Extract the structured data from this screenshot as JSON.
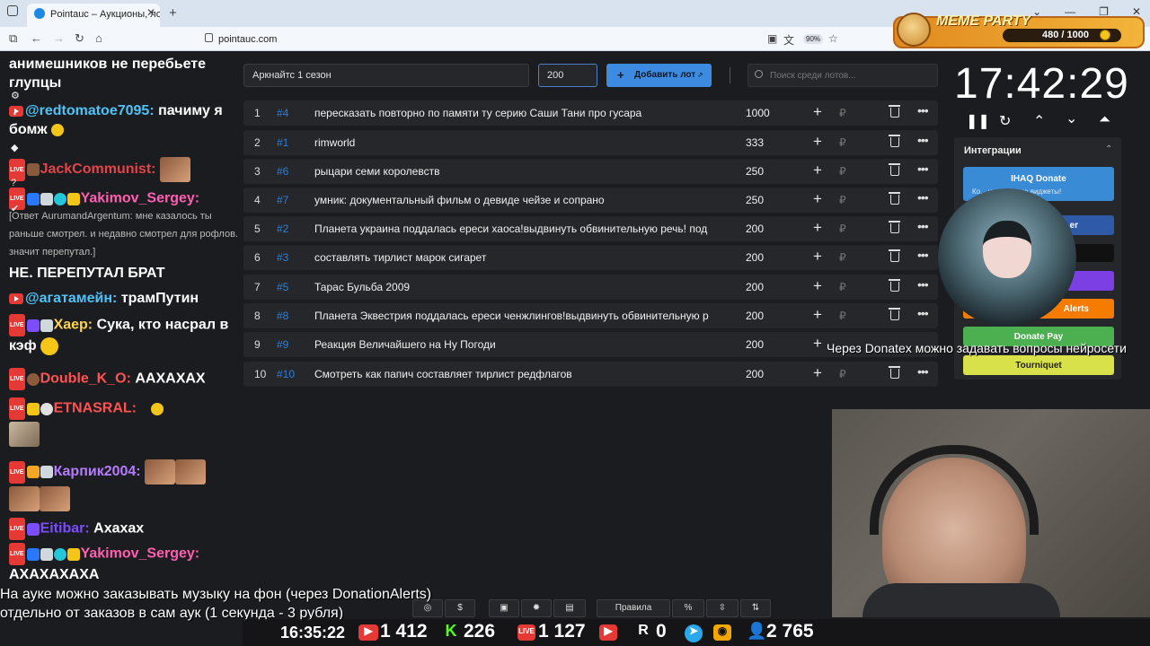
{
  "browser": {
    "tab_title": "Pointauc – Аукционы, лотереи",
    "url": "pointauc.com",
    "zoom": "90%"
  },
  "meme_party": {
    "title": "MEME PARTY",
    "count": "480 / 1000"
  },
  "chat": {
    "messages": [
      {
        "text": "анимешников не перебьете глупцы"
      },
      {
        "user": "@redtomatoe7095:",
        "text": "пачиму я бомж",
        "user_color": "#4fc3f7"
      },
      {
        "user": "JackCommunist:",
        "user_color": "#e0454a"
      },
      {
        "user": "Yakimov_Sergey:",
        "user_color": "#ff5fb0",
        "reply": "[Ответ AurumandArgentum: мне казалось ты раньше смотрел. и недавно смотрел для рофлов. значит перепутал.]",
        "text": "НЕ. ПЕРЕПУТАЛ БРАТ"
      },
      {
        "user": "@агатамейн:",
        "text": "трамПутин",
        "user_color": "#4fc3f7"
      },
      {
        "user": "Хаер:",
        "text": "Сука, кто насрал в кэф",
        "user_color": "#ffd54f"
      },
      {
        "user": "Double_K_O:",
        "text": "ААХАХАХ",
        "user_color": "#ff5252"
      },
      {
        "user": "ETNASRAL:",
        "user_color": "#ff5252"
      },
      {
        "user": "Карпик2004:",
        "user_color": "#b57bff"
      },
      {
        "user": "Eitibar:",
        "text": "Ахахах",
        "user_color": "#7c4dff"
      },
      {
        "user": "Yakimov_Sergey:",
        "text": "АХАХАХАХА",
        "user_color": "#ff5fb0"
      }
    ]
  },
  "form": {
    "lot_name": "Аркнайтс 1 сезон",
    "lot_amount": "200",
    "add_label": "Добавить лот",
    "search_placeholder": "Поиск среди лотов..."
  },
  "lots": [
    {
      "num": "1",
      "id": "#4",
      "name": "пересказать повторно по памяти ту серию Саши Тани про гусара",
      "amount": "1000"
    },
    {
      "num": "2",
      "id": "#1",
      "name": "rimworld",
      "amount": "333"
    },
    {
      "num": "3",
      "id": "#6",
      "name": "рыцари семи королевств",
      "amount": "250"
    },
    {
      "num": "4",
      "id": "#7",
      "name": "умник: документальный фильм о девиде чейзе и сопрано",
      "amount": "250"
    },
    {
      "num": "5",
      "id": "#2",
      "name": "Планета украина поддалась ереси хаоса!выдвинуть обвинительную речь! под",
      "amount": "200"
    },
    {
      "num": "6",
      "id": "#3",
      "name": "составлять тирлист марок сигарет",
      "amount": "200"
    },
    {
      "num": "7",
      "id": "#5",
      "name": "Тарас Бульба 2009",
      "amount": "200"
    },
    {
      "num": "8",
      "id": "#8",
      "name": "Планета Эквестрия поддалась ереси ченжлингов!выдвинуть обвинительную р",
      "amount": "200"
    },
    {
      "num": "9",
      "id": "#9",
      "name": "Реакция Величайшего на Ну Погоди",
      "amount": "200"
    },
    {
      "num": "10",
      "id": "#10",
      "name": "Смотреть как папич составляет тирлист редфлагов",
      "amount": "200"
    }
  ],
  "timer": {
    "value": "17:42:29"
  },
  "integrations": {
    "title": "Интеграции",
    "ihaq_label": "IHAQ Donate",
    "ihaq_sub": "Ко... уникальные виджеты!",
    "item3": "er",
    "alerts_label": "Alerts",
    "donatepay_label": "Donate Pay",
    "tourniquet_label": "Tourniquet",
    "colors": {
      "ihaq": "#3a8bd6",
      "donatepay": "#4caf50",
      "tourniquet": "#d8e04a",
      "alerts": "#f57c00",
      "purple": "#7b3fe4"
    }
  },
  "overlay": {
    "donatex": "Через Donatex можно задавать вопросы нейросети",
    "ticker_line1": "На ауке можно заказывать музыку на фон (через DonationAlerts)",
    "ticker_line2": "отдельно от заказов в сам аук (1 секунда - 3 рубля)"
  },
  "toolbar": {
    "rules": "Правила",
    "percent": "%"
  },
  "stats": {
    "clock": "16:35:22",
    "youtube": "1 412",
    "kick": "226",
    "live": "1 127",
    "rutube": "0",
    "total": "2 765"
  }
}
